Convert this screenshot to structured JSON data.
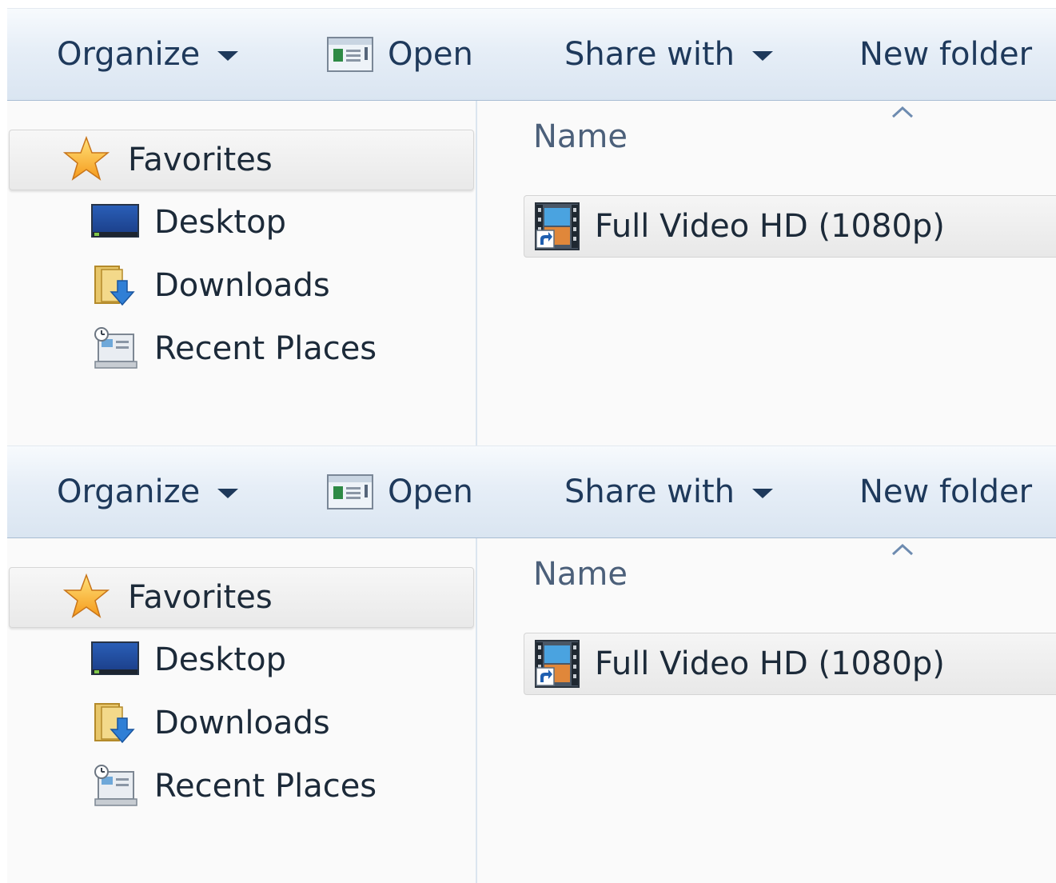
{
  "windows": [
    {
      "toolbar": {
        "organize_label": "Organize",
        "open_label": "Open",
        "share_label": "Share with",
        "new_folder_label": "New folder"
      },
      "nav": {
        "favorites_label": "Favorites",
        "items": [
          {
            "label": "Desktop",
            "icon": "desktop-icon"
          },
          {
            "label": "Downloads",
            "icon": "downloads-icon"
          },
          {
            "label": "Recent Places",
            "icon": "recent-places-icon"
          }
        ]
      },
      "content": {
        "column_header": "Name",
        "files": [
          {
            "name": "Full Video HD (1080p)",
            "icon": "video-shortcut-icon"
          }
        ]
      }
    },
    {
      "toolbar": {
        "organize_label": "Organize",
        "open_label": "Open",
        "share_label": "Share with",
        "new_folder_label": "New folder"
      },
      "nav": {
        "favorites_label": "Favorites",
        "items": [
          {
            "label": "Desktop",
            "icon": "desktop-icon"
          },
          {
            "label": "Downloads",
            "icon": "downloads-icon"
          },
          {
            "label": "Recent Places",
            "icon": "recent-places-icon"
          }
        ]
      },
      "content": {
        "column_header": "Name",
        "files": [
          {
            "name": "Full Video HD (1080p)",
            "icon": "video-shortcut-icon"
          }
        ]
      }
    }
  ],
  "colors": {
    "toolbar_text": "#1e395b",
    "toolbar_border": "#a8bdd3",
    "item_text": "#1c2a39",
    "header_text": "#4c607a"
  }
}
